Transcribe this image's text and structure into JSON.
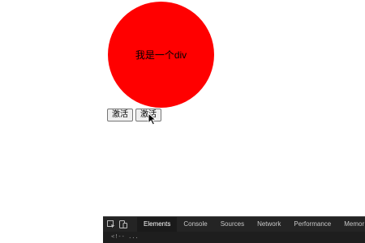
{
  "circle": {
    "text": "我是一个div",
    "color": "#ff0000"
  },
  "buttons": [
    {
      "label": "激活"
    },
    {
      "label": "激活"
    }
  ],
  "devtools": {
    "tabs": [
      "Elements",
      "Console",
      "Sources",
      "Network",
      "Performance",
      "Memor"
    ],
    "active_tab": "Elements",
    "source_line": "<!-- ..."
  }
}
